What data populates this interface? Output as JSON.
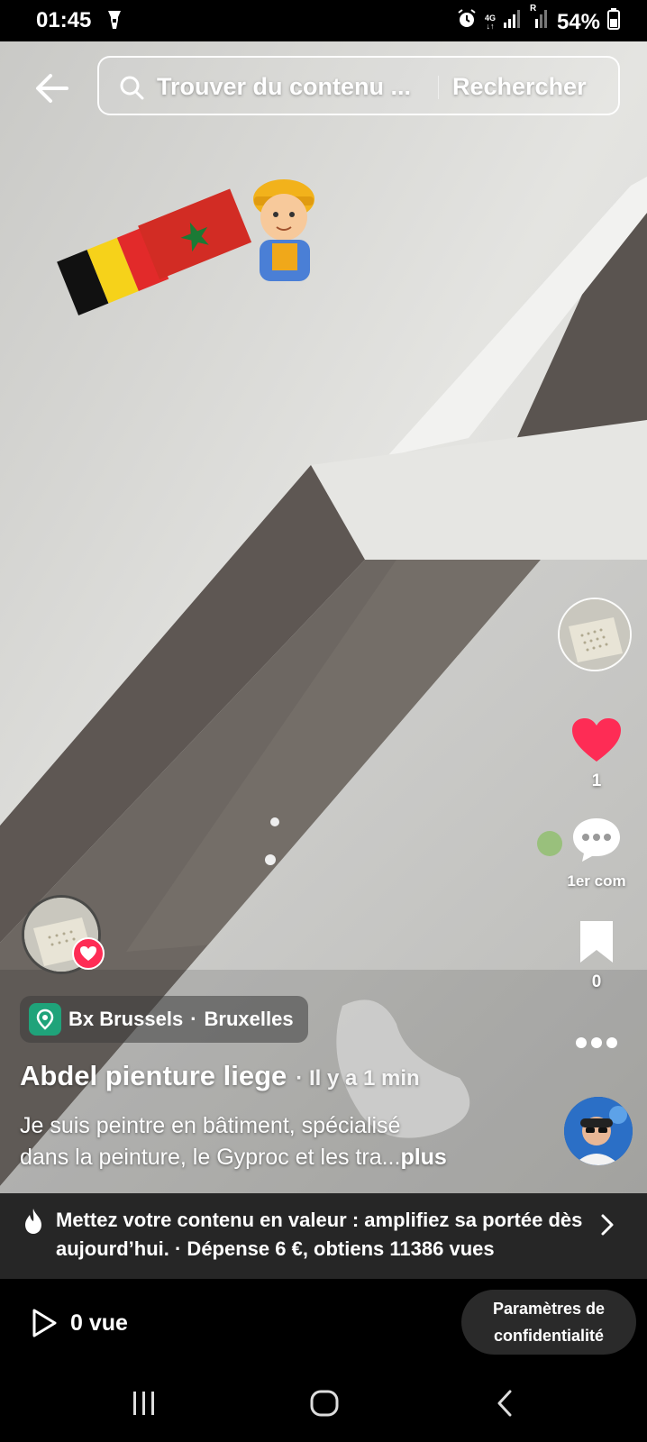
{
  "status_bar": {
    "time": "01:45",
    "network": "4G",
    "sim_label": "R",
    "battery": "54%",
    "icons": [
      "torch-icon",
      "alarm-icon",
      "signal-icon",
      "battery-icon"
    ]
  },
  "search": {
    "placeholder": "Trouver du contenu ...",
    "button_label": "Rechercher"
  },
  "actions": {
    "likes": "1",
    "comments": "1er com",
    "saves": "0"
  },
  "location": {
    "label": "Bx Brussels",
    "separator": "·",
    "city": "Bruxelles"
  },
  "post": {
    "author": "Abdel pienture liege",
    "time": "· Il y a 1 min",
    "caption_line1": "Je suis peintre en bâtiment, spécialisé",
    "caption_line2": "dans la peinture, le Gyproc et les tra...",
    "more_label": "plus"
  },
  "promo": {
    "text": "Mettez votre contenu en valeur : amplifiez sa portée dès aujourd’hui. · Dépense 6 €, obtiens 11386 vues"
  },
  "bottom": {
    "views": "0 vue",
    "privacy_line1": "Paramètres de",
    "privacy_line2": "confidentialité"
  },
  "colors": {
    "like": "#fe2c55",
    "location_icon_bg": "#1fa37a",
    "promo_bg": "#262626"
  }
}
